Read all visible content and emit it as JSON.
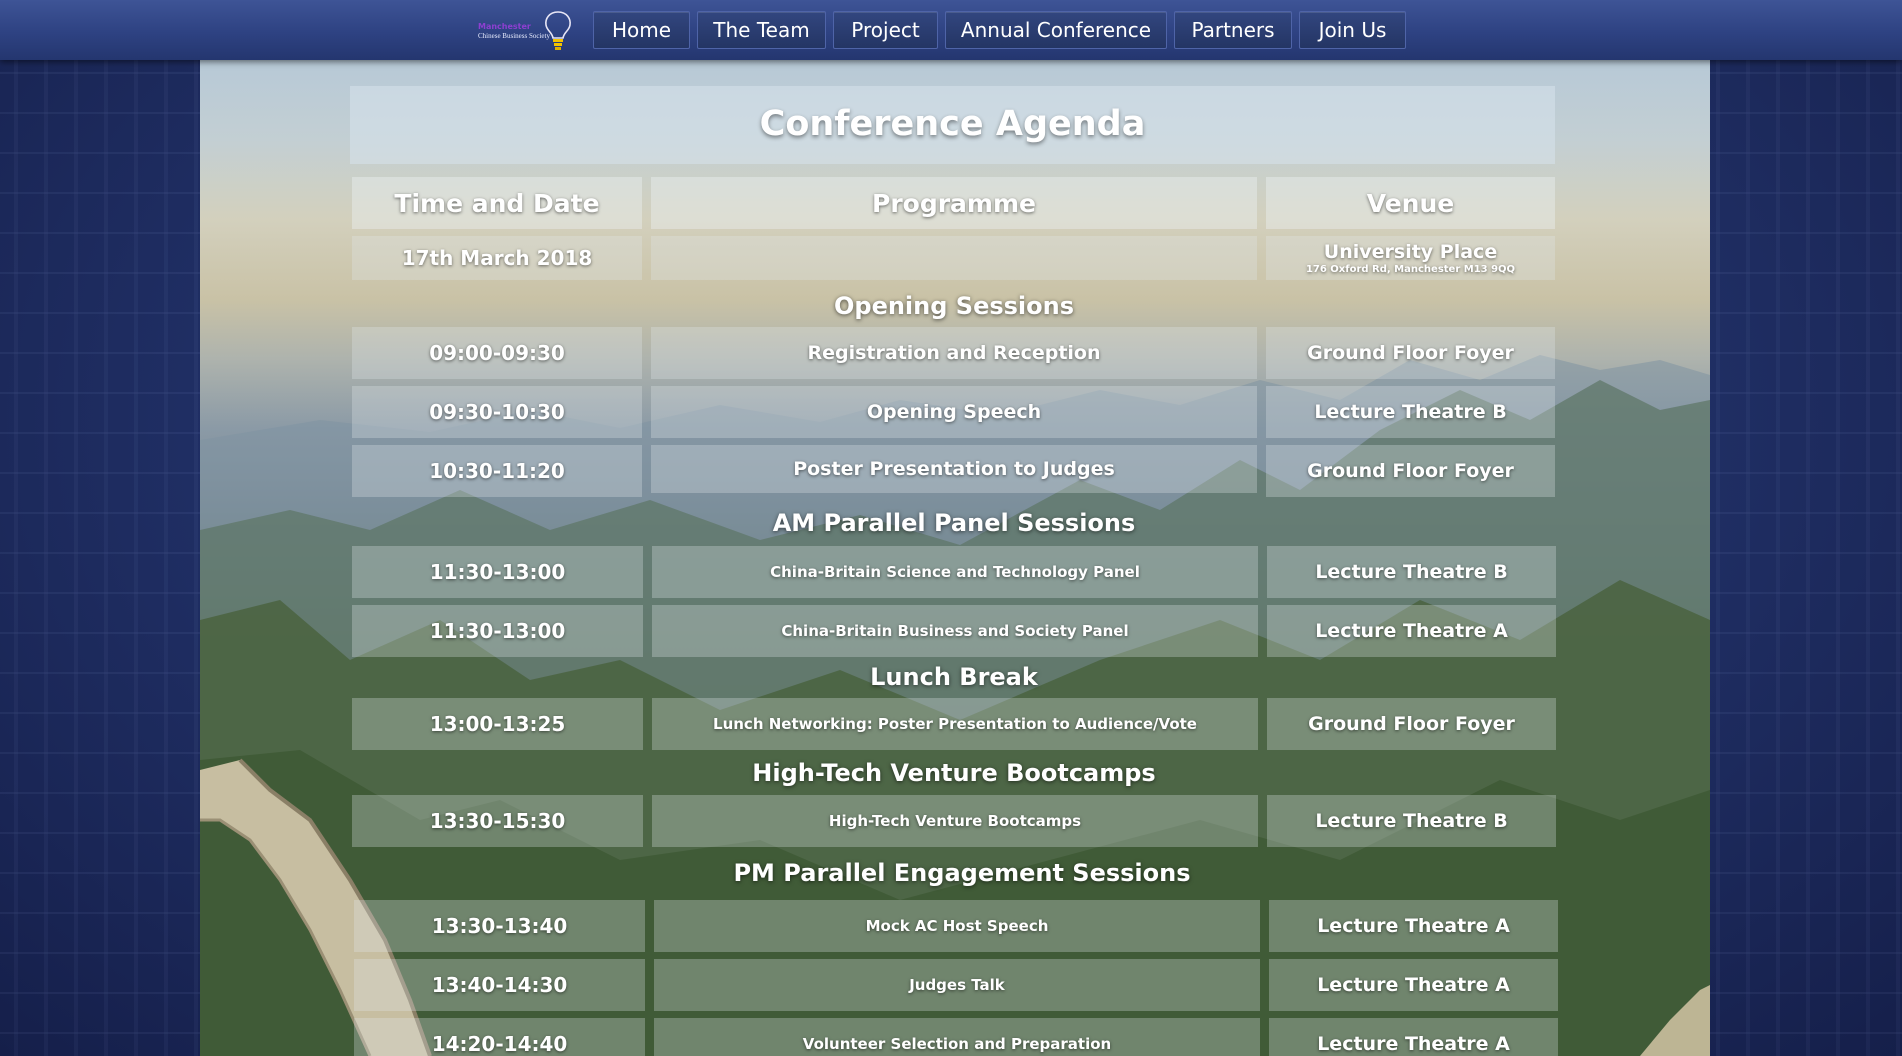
{
  "logo": {
    "line1": "Manchester",
    "line2": "Chinese Business Society"
  },
  "nav": {
    "items": [
      {
        "label": "Home"
      },
      {
        "label": "The Team"
      },
      {
        "label": "Project"
      },
      {
        "label": "Annual Conference"
      },
      {
        "label": "Partners"
      },
      {
        "label": "Join Us"
      }
    ]
  },
  "agenda": {
    "title": "Conference Agenda",
    "headers": {
      "time": "Time and Date",
      "programme": "Programme",
      "venue": "Venue"
    },
    "date_row": {
      "date": "17th March 2018",
      "programme": "",
      "venue": "University Place",
      "address": "176 Oxford Rd, Manchester M13 9QQ"
    },
    "sections": [
      {
        "title": "Opening Sessions",
        "rows": [
          {
            "time": "09:00-09:30",
            "programme": "Registration and Reception",
            "venue": "Ground Floor Foyer"
          },
          {
            "time": "09:30-10:30",
            "programme": "Opening Speech",
            "venue": "Lecture Theatre B"
          },
          {
            "time": "10:30-11:20",
            "programme": "Poster Presentation to Judges",
            "venue": "Ground Floor Foyer"
          }
        ]
      },
      {
        "title": "AM Parallel Panel Sessions",
        "rows": [
          {
            "time": "11:30-13:00",
            "programme": "China-Britain Science and Technology Panel",
            "venue": "Lecture Theatre B"
          },
          {
            "time": "11:30-13:00",
            "programme": "China-Britain Business and Society Panel",
            "venue": "Lecture Theatre A"
          }
        ]
      },
      {
        "title": "Lunch Break",
        "rows": [
          {
            "time": "13:00-13:25",
            "programme": "Lunch Networking: Poster Presentation to Audience/Vote",
            "venue": "Ground Floor Foyer"
          }
        ]
      },
      {
        "title": "High-Tech Venture Bootcamps",
        "rows": [
          {
            "time": "13:30-15:30",
            "programme": "High-Tech Venture Bootcamps",
            "venue": "Lecture Theatre B"
          }
        ]
      },
      {
        "title": "PM Parallel Engagement Sessions",
        "rows": [
          {
            "time": "13:30-13:40",
            "programme": "Mock AC Host Speech",
            "venue": "Lecture Theatre A"
          },
          {
            "time": "13:40-14:30",
            "programme": "Judges Talk",
            "venue": "Lecture Theatre A"
          },
          {
            "time": "14:20-14:40",
            "programme": "Volunteer Selection and Preparation",
            "venue": "Lecture Theatre A"
          }
        ]
      }
    ]
  }
}
